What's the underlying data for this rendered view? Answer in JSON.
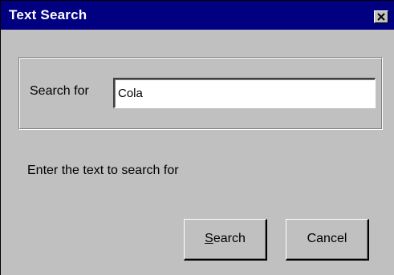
{
  "window": {
    "title": "Text Search",
    "close_icon": "close-x-icon"
  },
  "search": {
    "label": "Search for",
    "value": "Cola"
  },
  "hint": "Enter the text to search for",
  "buttons": {
    "search_label": "Search",
    "cancel_label": "Cancel"
  },
  "colors": {
    "titlebar": "#000080",
    "face": "#c0c0c0",
    "title_text": "#ffffff"
  }
}
